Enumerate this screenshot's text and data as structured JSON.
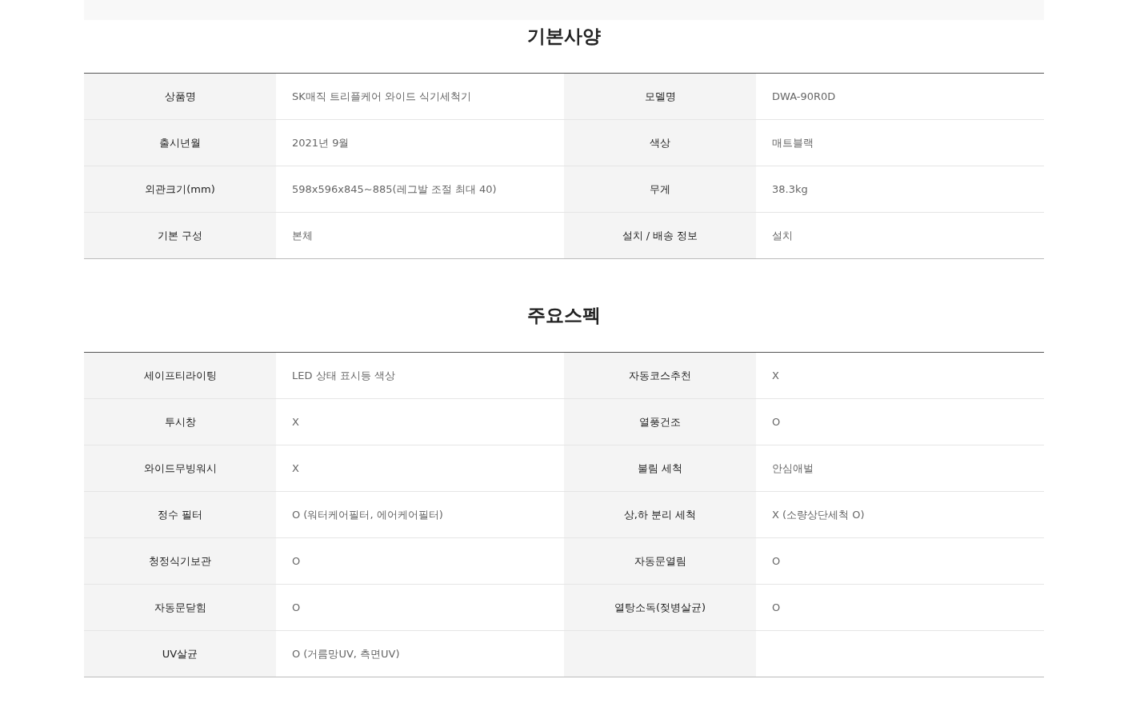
{
  "sections": [
    {
      "title": "기본사양",
      "rows": [
        [
          {
            "label": "상품명",
            "value": "SK매직 트리플케어 와이드 식기세척기"
          },
          {
            "label": "모델명",
            "value": "DWA-90R0D"
          }
        ],
        [
          {
            "label": "출시년월",
            "value": "2021년 9월"
          },
          {
            "label": "색상",
            "value": "매트블랙"
          }
        ],
        [
          {
            "label": "외관크기(mm)",
            "value": "598x596x845~885(레그발 조절 최대 40)"
          },
          {
            "label": "무게",
            "value": "38.3kg"
          }
        ],
        [
          {
            "label": "기본 구성",
            "value": "본체"
          },
          {
            "label": "설치 / 배송 정보",
            "value": "설치"
          }
        ]
      ]
    },
    {
      "title": "주요스펙",
      "rows": [
        [
          {
            "label": "세이프티라이팅",
            "value": "LED 상태 표시등 색상"
          },
          {
            "label": "자동코스추천",
            "value": "X"
          }
        ],
        [
          {
            "label": "투시창",
            "value": "X"
          },
          {
            "label": "열풍건조",
            "value": "O"
          }
        ],
        [
          {
            "label": "와이드무빙워시",
            "value": "X"
          },
          {
            "label": "불림 세척",
            "value": "안심애벌"
          }
        ],
        [
          {
            "label": "정수 필터",
            "value": "O (워터케어필터, 에어케어필터)"
          },
          {
            "label": "상,하 분리 세척",
            "value": "X (소량상단세척 O)"
          }
        ],
        [
          {
            "label": "청정식기보관",
            "value": "O"
          },
          {
            "label": "자동문열림",
            "value": "O"
          }
        ],
        [
          {
            "label": "자동문닫힘",
            "value": "O"
          },
          {
            "label": "열탕소독(젖병살균)",
            "value": "O"
          }
        ],
        [
          {
            "label": "UV살균",
            "value": "O (거름망UV, 측면UV)"
          }
        ]
      ]
    }
  ]
}
